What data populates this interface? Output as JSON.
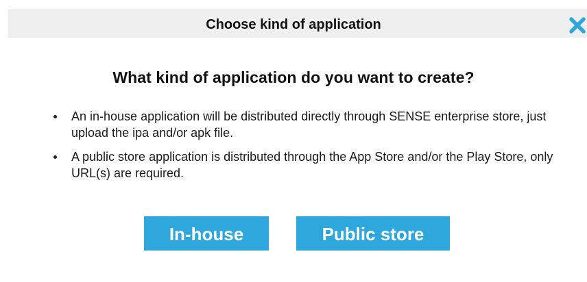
{
  "dialog": {
    "title": "Choose kind of application",
    "heading": "What kind of application do you want to create?",
    "bullets": [
      "An in-house application will be distributed directly through SENSE enterprise store, just upload the ipa and/or apk file.",
      "A public store application is distributed through the App Store and/or the Play Store, only URL(s) are required."
    ],
    "buttons": {
      "inhouse_label": "In-house",
      "public_label": "Public store"
    },
    "close_icon": "close-icon"
  },
  "colors": {
    "accent": "#2ea8dc",
    "titlebar_bg": "#efefef",
    "close_icon": "#2ea8dc"
  }
}
